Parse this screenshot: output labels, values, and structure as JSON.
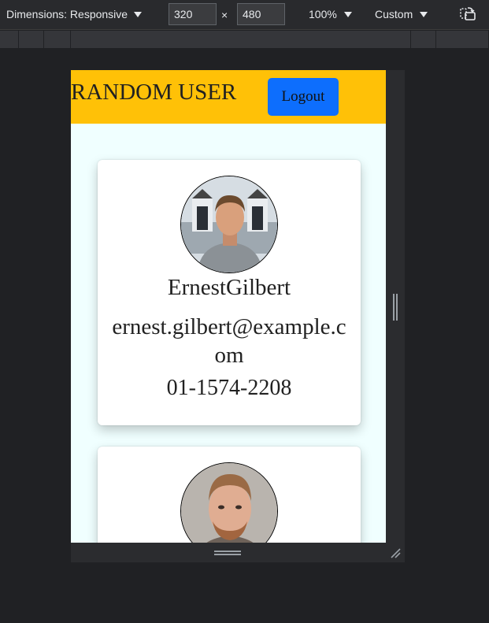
{
  "toolbar": {
    "dimensions_label": "Dimensions: Responsive",
    "width": "320",
    "height": "480",
    "times": "×",
    "zoom": "100%",
    "throttle": "Custom",
    "icons": [
      "caret-down-icon",
      "rotate-icon"
    ]
  },
  "app": {
    "brand": "RANDOM USER",
    "logout_label": "Logout",
    "colors": {
      "header_bg": "#ffc107",
      "page_bg": "#f0ffff",
      "logout_bg": "#0d6efd"
    }
  },
  "users": [
    {
      "name": "ErnestGilbert",
      "email": "ernest.gilbert@example.com",
      "phone": "01-1574-2208"
    },
    {}
  ]
}
